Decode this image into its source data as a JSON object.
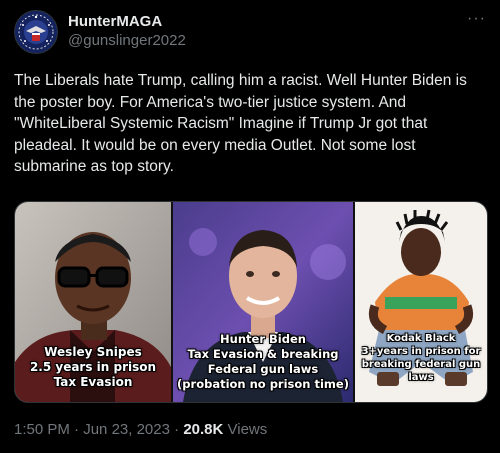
{
  "author": {
    "display_name": "HunterMAGA",
    "handle": "@gunslinger2022",
    "avatar_icon": "eagle-seal-icon"
  },
  "more_icon": "more-options-icon",
  "more_label": "···",
  "tweet": {
    "text": "The Liberals hate Trump, calling him a racist. Well Hunter Biden is the poster boy. For America's two-tier justice system. And \"WhiteLiberal Systemic Racism\" Imagine if Trump Jr got that pleadeal. It would be on every media Outlet. Not some lost submarine as top story."
  },
  "media": {
    "panels": [
      {
        "caption_lines": [
          "Wesley Snipes",
          "2.5 years in prison",
          "Tax Evasion"
        ]
      },
      {
        "caption_lines": [
          "Hunter Biden",
          "Tax Evasion & breaking",
          "Federal gun laws",
          "(probation no prison time)"
        ]
      },
      {
        "caption_lines": [
          "Kodak Black",
          "3+years in prison for",
          "breaking federal gun laws"
        ]
      }
    ]
  },
  "footer": {
    "time": "1:50 PM",
    "sep1": " · ",
    "date": "Jun 23, 2023",
    "sep2": " · ",
    "views_count": "20.8K",
    "views_label": " Views"
  },
  "colors": {
    "background": "#000000",
    "text": "#e7e9ea",
    "muted": "#71767b"
  }
}
